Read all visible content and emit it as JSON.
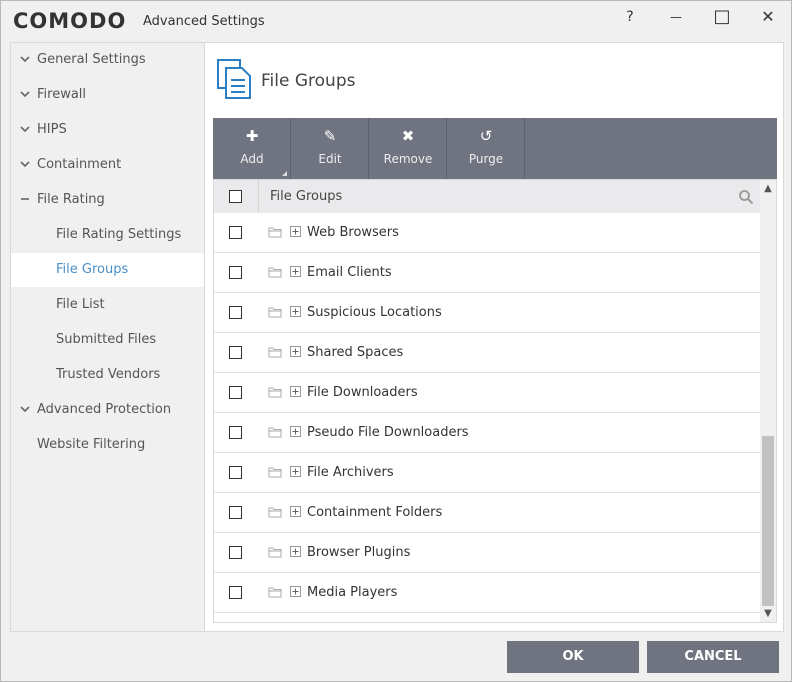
{
  "window": {
    "brand": "COMODO",
    "title": "Advanced Settings",
    "help_glyph": "?",
    "minimize_glyph": "—",
    "maximize_glyph": "□",
    "close_glyph": "✕"
  },
  "sidebar": {
    "items": [
      {
        "label": "General Settings",
        "icon": "chevron-down-icon"
      },
      {
        "label": "Firewall",
        "icon": "chevron-down-icon"
      },
      {
        "label": "HIPS",
        "icon": "chevron-down-icon"
      },
      {
        "label": "Containment",
        "icon": "chevron-down-icon"
      },
      {
        "label": "File Rating",
        "icon": "minus-icon"
      },
      {
        "label": "File Rating Settings"
      },
      {
        "label": "File Groups",
        "active": true
      },
      {
        "label": "File List"
      },
      {
        "label": "Submitted Files"
      },
      {
        "label": "Trusted Vendors"
      },
      {
        "label": "Advanced Protection",
        "icon": "chevron-down-icon"
      },
      {
        "label": "Website Filtering"
      }
    ]
  },
  "main": {
    "page_title": "File Groups",
    "page_icon": "document-stack-icon",
    "toolbar": {
      "add": {
        "label": "Add",
        "glyph": "✚",
        "icon": "plus-icon"
      },
      "edit": {
        "label": "Edit",
        "glyph": "✎",
        "icon": "pencil-icon"
      },
      "remove": {
        "label": "Remove",
        "glyph": "✖",
        "icon": "x-icon"
      },
      "purge": {
        "label": "Purge",
        "glyph": "↺",
        "icon": "refresh-icon"
      }
    },
    "grid": {
      "header": "File Groups",
      "rows": [
        "Web Browsers",
        "Email Clients",
        "Suspicious Locations",
        "Shared Spaces",
        "File Downloaders",
        "Pseudo File Downloaders",
        "File Archivers",
        "Containment Folders",
        "Browser Plugins",
        "Media Players"
      ],
      "scroll_up_glyph": "▲",
      "scroll_down_glyph": "▼"
    }
  },
  "footer": {
    "ok": "OK",
    "cancel": "CANCEL"
  },
  "colors": {
    "toolbar": "#6f7480",
    "active_link": "#4a90c8",
    "icon_blue": "#2a7fc4"
  }
}
